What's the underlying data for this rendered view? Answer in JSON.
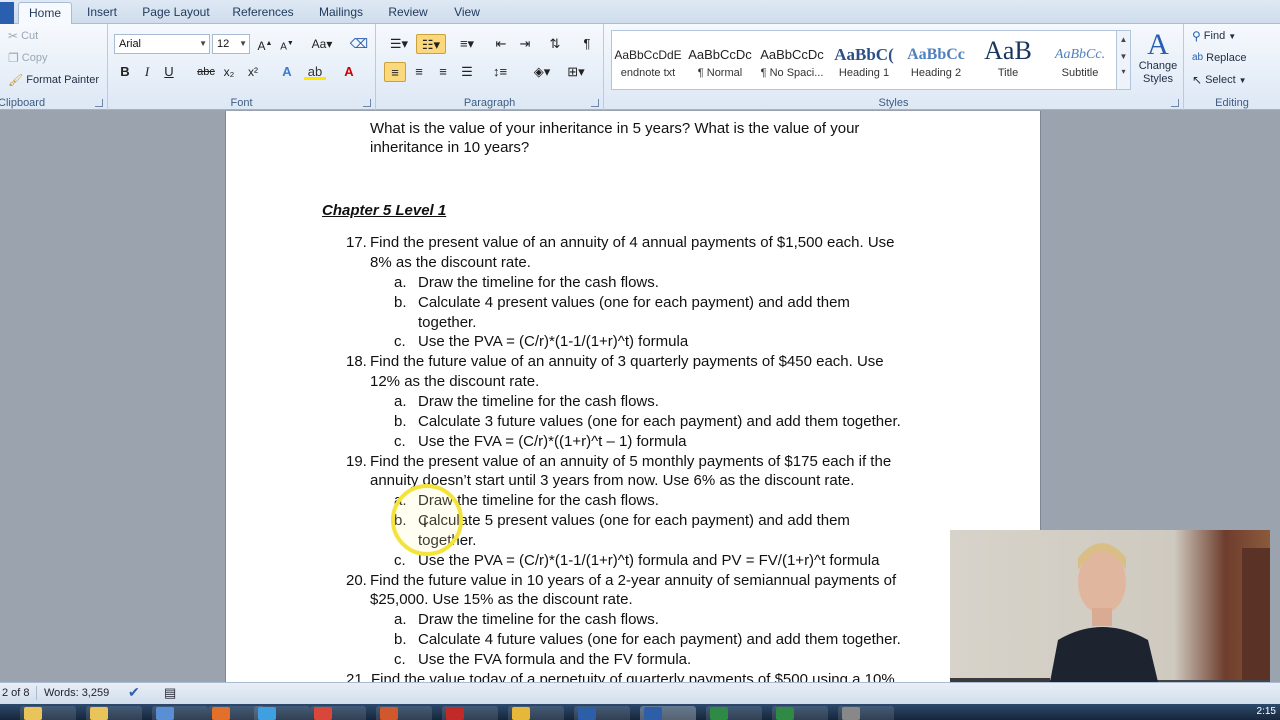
{
  "tabs": [
    "Home",
    "Insert",
    "Page Layout",
    "References",
    "Mailings",
    "Review",
    "View"
  ],
  "active_tab": "Home",
  "clipboard": {
    "cut": "Cut",
    "copy": "Copy",
    "format_painter": "Format Painter",
    "label": "Clipboard"
  },
  "font": {
    "name": "Arial",
    "size": "12",
    "label": "Font",
    "bold": "B",
    "italic": "I",
    "underline": "U",
    "strike": "abc",
    "sub": "x₂",
    "sup": "x²"
  },
  "paragraph": {
    "label": "Paragraph",
    "pilcrow": "¶"
  },
  "styles": {
    "label": "Styles",
    "items": [
      {
        "sample": "AaBbCcDdE",
        "name": "endnote txt"
      },
      {
        "sample": "AaBbCcDc",
        "name": "¶ Normal"
      },
      {
        "sample": "AaBbCcDc",
        "name": "¶ No Spaci..."
      },
      {
        "sample": "AaBbC(",
        "name": "Heading 1"
      },
      {
        "sample": "AaBbCc",
        "name": "Heading 2"
      },
      {
        "sample": "AaB",
        "name": "Title"
      },
      {
        "sample": "AaBbCc.",
        "name": "Subtitle"
      }
    ],
    "change_styles": "Change Styles"
  },
  "editing": {
    "label": "Editing",
    "find": "Find",
    "replace": "Replace",
    "select": "Select"
  },
  "document": {
    "lines": [
      "What is the value of your inheritance in 5 years?  What is the value of your",
      "inheritance in 10 years?"
    ],
    "heading": "Chapter 5 Level 1",
    "q17": {
      "num": "17.",
      "text1": "Find the present value of an annuity of 4 annual payments of $1,500 each.  Use",
      "text2": "8% as the discount rate.",
      "a": "Draw the timeline for the cash flows.",
      "b1": "Calculate 4 present values (one for each payment) and add them",
      "b2": "together.",
      "c": "Use the PVA = (C/r)*(1-1/(1+r)^t)  formula"
    },
    "q18": {
      "num": "18.",
      "text1": "Find the future value of an annuity of 3 quarterly payments of $450 each.  Use",
      "text2": "12% as the discount rate.",
      "a": "Draw the timeline for the cash flows.",
      "b1": "Calculate 3 future values (one for each payment) and add them together.",
      "c": "Use the FVA = (C/r)*((1+r)^t  – 1) formula"
    },
    "q19": {
      "num": "19.",
      "text1": "Find the present value of an annuity of 5 monthly payments of $175 each if the",
      "text2": "annuity doesn’t start until 3 years from now.  Use 6% as the discount rate.",
      "a": "Draw the timeline for the cash flows.",
      "b1": "Calculate 5 present values (one for each payment) and add them",
      "b2": "together.",
      "c": "Use the PVA = (C/r)*(1-1/(1+r)^t)  formula and PV = FV/(1+r)^t  formula"
    },
    "q20": {
      "num": "20.",
      "text1": "Find the future value in 10 years of a 2-year annuity of semiannual payments of",
      "text2": "$25,000.  Use 15% as the discount rate.",
      "a": "Draw the timeline for the cash flows.",
      "b1": "Calculate 4 future values (one for each payment) and add them together.",
      "c": "Use the FVA formula and the FV formula."
    },
    "q21": "21. Find the value today of a perpetuity of quarterly payments of $500 using a 10%",
    "markers": {
      "a": "a.",
      "b": "b.",
      "c": "c."
    }
  },
  "status": {
    "page": "2 of 8",
    "words": "Words: 3,259"
  },
  "clock": "2:15"
}
